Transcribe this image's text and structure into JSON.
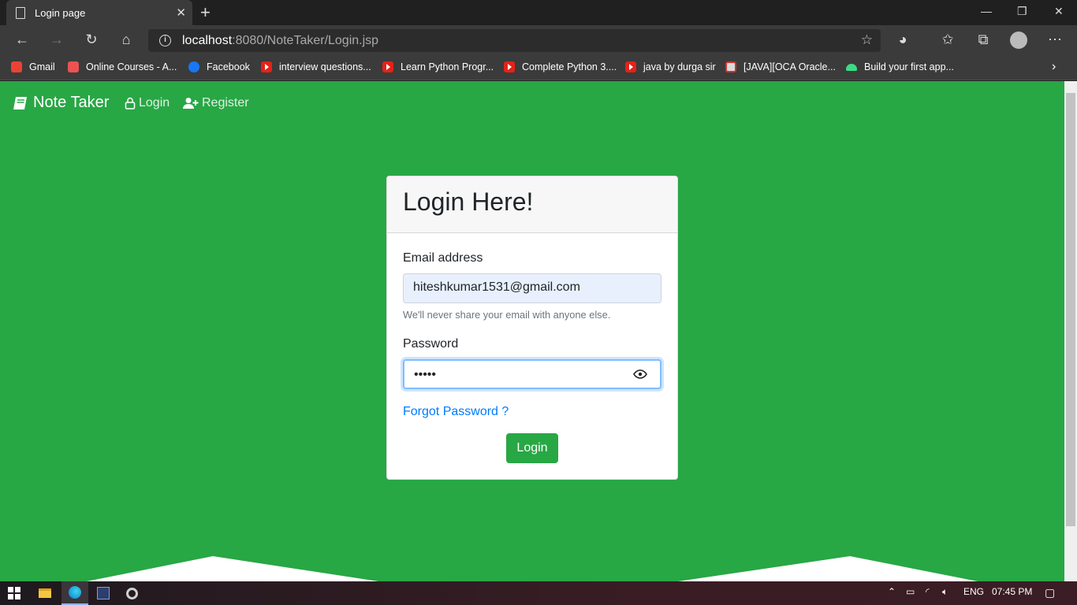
{
  "browser": {
    "tab_title": "Login page",
    "tab_close": "✕",
    "new_tab": "+",
    "url_host": "localhost",
    "url_rest": ":8080/NoteTaker/Login.jsp",
    "window_controls": {
      "minimize": "—",
      "restore": "❐",
      "close": "✕"
    },
    "nav_icons": [
      "back-icon",
      "forward-icon",
      "refresh-icon",
      "home-icon"
    ],
    "bookmarks": [
      {
        "label": "Gmail",
        "icon": "gmail-icon",
        "color": "#ea4335"
      },
      {
        "label": "Online Courses - A...",
        "icon": "udemy-icon",
        "color": "#ec5252"
      },
      {
        "label": "Facebook",
        "icon": "facebook-icon",
        "color": "#1877f2"
      },
      {
        "label": "interview questions...",
        "icon": "youtube-icon",
        "color": "#e62117"
      },
      {
        "label": "Learn Python Progr...",
        "icon": "youtube-icon",
        "color": "#e62117"
      },
      {
        "label": "Complete Python 3....",
        "icon": "youtube-icon",
        "color": "#e62117"
      },
      {
        "label": "java by durga sir",
        "icon": "youtube-icon",
        "color": "#e62117"
      },
      {
        "label": "[JAVA][OCA Oracle...",
        "icon": "pdf-icon",
        "color": "#d9d9d9"
      },
      {
        "label": "Build your first app...",
        "icon": "android-icon",
        "color": "#3ddc84"
      }
    ]
  },
  "navbar": {
    "brand": "Note Taker",
    "login": "Login",
    "register": "Register"
  },
  "login_card": {
    "title": "Login Here!",
    "email_label": "Email address",
    "email_value": "hiteshkumar1531@gmail.com",
    "email_help": "We'll never share your email with anyone else.",
    "password_label": "Password",
    "password_value": "•••••",
    "forgot": "Forgot Password ?",
    "submit": "Login"
  },
  "taskbar": {
    "language": "ENG",
    "time": "07:45 PM"
  },
  "colors": {
    "page_bg": "#28a745",
    "link": "#007bff",
    "button": "#28a745"
  }
}
